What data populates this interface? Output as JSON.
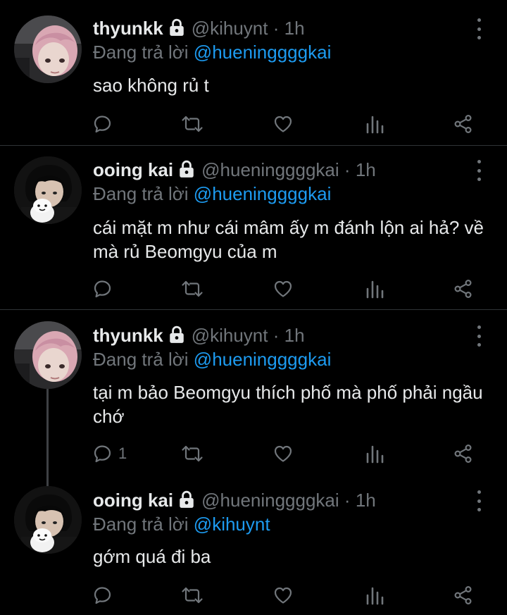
{
  "tweets": [
    {
      "name": "thyunkk",
      "handle": "@kihuynt",
      "dot": "·",
      "time": "1h",
      "reply_prefix": "Đang trả lời",
      "reply_to": "@hueninggggkai",
      "text": "sao không rủ t",
      "reply_count": "",
      "avatar": "pink-hair-avatar"
    },
    {
      "name": "ooing kai",
      "handle": "@hueninggggkai",
      "dot": "·",
      "time": "1h",
      "reply_prefix": "Đang trả lời",
      "reply_to": "@hueninggggkai",
      "text": "cái mặt m như cái mâm ấy m đánh lộn ai hả? về mà rủ Beomgyu của m",
      "reply_count": "",
      "avatar": "dark-hair-plush-avatar"
    },
    {
      "name": "thyunkk",
      "handle": "@kihuynt",
      "dot": "·",
      "time": "1h",
      "reply_prefix": "Đang trả lời",
      "reply_to": "@hueninggggkai",
      "text": "tại m bảo Beomgyu thích phố mà phố phải ngầu chớ",
      "reply_count": "1",
      "avatar": "pink-hair-avatar"
    },
    {
      "name": "ooing kai",
      "handle": "@hueninggggkai",
      "dot": "·",
      "time": "1h",
      "reply_prefix": "Đang trả lời",
      "reply_to": "@kihuynt",
      "text": "gớm quá đi ba",
      "reply_count": "",
      "avatar": "dark-hair-plush-avatar"
    }
  ],
  "icons": [
    "lock-icon",
    "more-icon",
    "reply-icon",
    "retweet-icon",
    "like-icon",
    "analytics-icon",
    "share-icon"
  ],
  "colors": {
    "background": "#000000",
    "text": "#e7e9ea",
    "muted": "#71767b",
    "link": "#1d9bf0",
    "divider": "#2f3336"
  }
}
